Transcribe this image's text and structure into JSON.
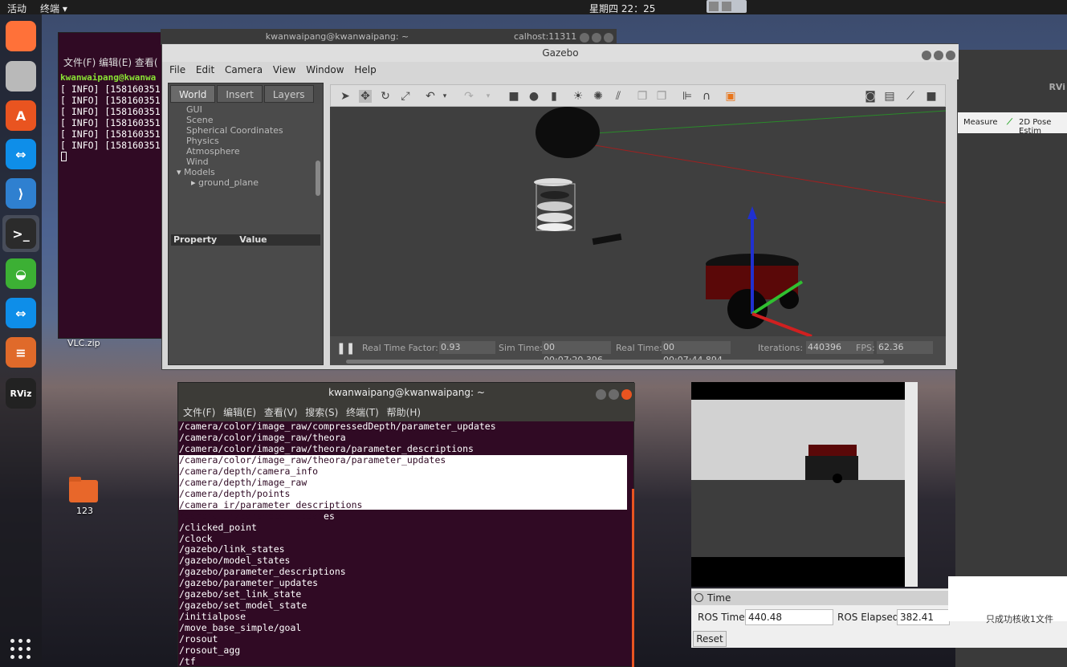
{
  "topbar": {
    "activities": "活动",
    "app": "终端 ▾",
    "clock": "星期四 22：25"
  },
  "desktop": {
    "vlc_label": "VLC.zip",
    "folder_label": "123"
  },
  "dock": {
    "items": [
      {
        "name": "firefox-icon",
        "glyph": "",
        "color": "#ff7139"
      },
      {
        "name": "files-icon",
        "glyph": "",
        "color": "#b9b9b9"
      },
      {
        "name": "software-center-icon",
        "glyph": "A",
        "color": "#e95420"
      },
      {
        "name": "teamviewer-icon",
        "glyph": "⇔",
        "color": "#0e8ee9"
      },
      {
        "name": "vscode-icon",
        "glyph": "⟩",
        "color": "#2f80d0"
      },
      {
        "name": "terminal-icon",
        "glyph": ">_",
        "color": "#2b2b2b"
      },
      {
        "name": "wechat-icon",
        "glyph": "◒",
        "color": "#3cb034"
      },
      {
        "name": "teamviewer2-icon",
        "glyph": "⇔",
        "color": "#0e8ee9"
      },
      {
        "name": "stack-icon",
        "glyph": "≡",
        "color": "#e06a2a"
      },
      {
        "name": "rviz-icon",
        "glyph": "RViz",
        "color": "#222222"
      }
    ]
  },
  "term1": {
    "menu": "文件(F)  编辑(E)  查看(",
    "prompt": "kwanwaipang@kwanwa",
    "lines": "[ INFO] [158160351\n[ INFO] [158160351\n[ INFO] [158160351\n[ INFO] [158160351\n[ INFO] [158160351\n[ INFO] [158160351"
  },
  "term2": {
    "title": "kwanwaipang@kwanwaipang: ~"
  },
  "localhost": {
    "title": "calhost:11311"
  },
  "gazebo": {
    "title": "Gazebo",
    "menu": [
      "File",
      "Edit",
      "Camera",
      "View",
      "Window",
      "Help"
    ],
    "tabs": [
      "World",
      "Insert",
      "Layers"
    ],
    "tree": [
      "GUI",
      "Scene",
      "Spherical Coordinates",
      "Physics",
      "Atmosphere",
      "Wind"
    ],
    "models": "Models",
    "ground_plane": "ground_plane",
    "prop_header": "Property",
    "value_header": "Value",
    "status": {
      "pause": "❚❚",
      "rtf_label": "Real Time Factor:",
      "rtf": "0.93",
      "sim_label": "Sim Time:",
      "sim": "00 00:07:20.396",
      "real_label": "Real Time:",
      "real": "00 00:07:44.894",
      "iter_label": "Iterations:",
      "iter": "440396",
      "fps_label": "FPS:",
      "fps": "62.36"
    }
  },
  "rviz": {
    "label": "RVi",
    "measure": "Measure",
    "pose": "2D Pose Estim"
  },
  "timepanel": {
    "title": "Time",
    "ros_time_label": "ROS Time:",
    "ros_time": "440.48",
    "ros_elapsed_label": "ROS Elapsed:",
    "ros_elapsed": "382.41",
    "reset": "Reset",
    "notif": "只成功核收1文件"
  },
  "term3": {
    "title": "kwanwaipang@kwanwaipang: ~",
    "menu": [
      "文件(F)",
      "编辑(E)",
      "查看(V)",
      "搜索(S)",
      "终端(T)",
      "帮助(H)"
    ],
    "lines_top": "/camera/color/image_raw/compressedDepth/parameter_updates\n/camera/color/image_raw/theora\n/camera/color/image_raw/theora/parameter_descriptions",
    "lines_sel": "/camera/color/image_raw/theora/parameter_updates\n/camera/depth/camera_info\n/camera/depth/image_raw\n/camera/depth/points\n/camera_ir/parameter_descriptions\n/camera_ir/parameter_updat",
    "lines_sel_tail": "es",
    "lines_bottom": "/clicked_point\n/clock\n/gazebo/link_states\n/gazebo/model_states\n/gazebo/parameter_descriptions\n/gazebo/parameter_updates\n/gazebo/set_link_state\n/gazebo/set_model_state\n/initialpose\n/move_base_simple/goal\n/rosout\n/rosout_agg\n/tf"
  }
}
